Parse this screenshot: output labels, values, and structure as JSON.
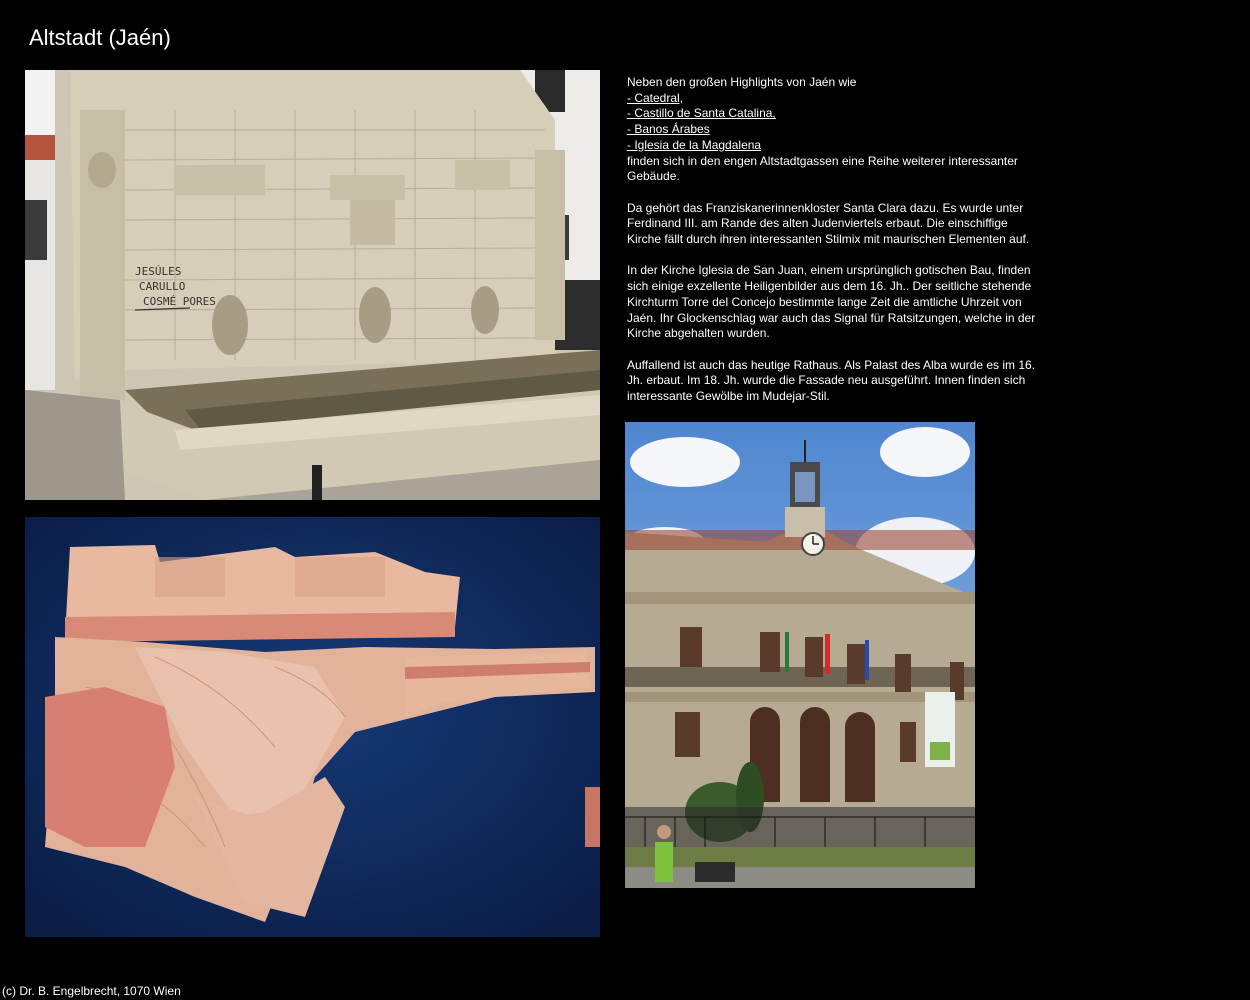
{
  "page": {
    "title": "Altstadt (Jaén)",
    "footer": "(c) Dr. B. Engelbrecht, 1070 Wien"
  },
  "photos": {
    "fountain": {
      "graffiti": [
        "JESÚLES",
        "CARULLO",
        "COSMÉ PORES"
      ]
    }
  },
  "text": {
    "intro": "Neben den großen Highlights von Jaén wie",
    "links": [
      {
        "label": "- Catedral,"
      },
      {
        "label": "- Castillo de Santa Catalina,"
      },
      {
        "label": "- Banos Árabes"
      },
      {
        "label": "- Iglesia de la Magdalena"
      }
    ],
    "intro_after": "finden sich in den engen Altstadtgassen eine Reihe weiterer interessanter Gebäude.",
    "paragraph_1": "Da gehört das Franziskanerinnenkloster Santa Clara dazu. Es wurde unter Ferdinand III. am Rande des alten Judenviertels erbaut. Die einschiffige Kirche fällt durch ihren interessanten Stilmix mit maurischen Elementen auf.",
    "paragraph_2": "In der Kirche Iglesia de San Juan, einem ursprünglich gotischen Bau, finden sich einige exzellente Heiligenbilder aus dem 16. Jh.. Der seitliche stehende Kirchturm Torre del Concejo bestimmte lange Zeit die amtliche Uhrzeit von Jaén. Ihr Glockenschlag war auch das Signal für Ratsitzungen, welche in der Kirche abgehalten wurden.",
    "paragraph_3": "Auffallend ist auch das heutige Rathaus. Als Palast des Alba wurde es im 16. Jh. erbaut. Im 18. Jh. wurde die Fassade neu ausgeführt. Innen finden sich interessante Gewölbe im Mudejar-Stil."
  }
}
